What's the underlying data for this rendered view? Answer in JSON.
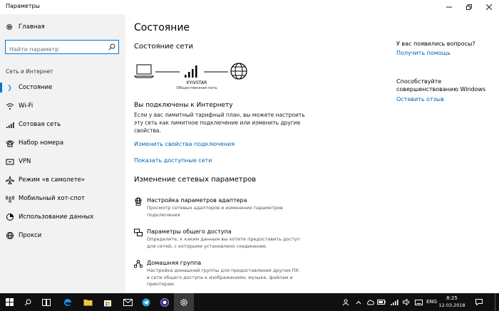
{
  "window": {
    "title": "Параметры"
  },
  "sidebar": {
    "home_label": "Главная",
    "search_placeholder": "Найти параметр",
    "section_title": "Сеть и Интернет",
    "items": [
      {
        "label": "Состояние",
        "icon": "status-icon",
        "active": true
      },
      {
        "label": "Wi-Fi",
        "icon": "wifi-icon"
      },
      {
        "label": "Сотовая сеть",
        "icon": "cellular-icon"
      },
      {
        "label": "Набор номера",
        "icon": "dialup-icon"
      },
      {
        "label": "VPN",
        "icon": "vpn-icon"
      },
      {
        "label": "Режим «в самолете»",
        "icon": "airplane-icon"
      },
      {
        "label": "Мобильный хот-спот",
        "icon": "hotspot-icon"
      },
      {
        "label": "Использование данных",
        "icon": "data-usage-icon"
      },
      {
        "label": "Прокси",
        "icon": "proxy-icon"
      }
    ]
  },
  "main": {
    "title": "Состояние",
    "network_status_heading": "Состояние сети",
    "network_name": "KYIVSTAR",
    "network_type": "Общественная сеть",
    "connected_text": "Вы подключены к Интернету",
    "connected_desc": "Если у вас лимитный тарифный план, вы можете настроить эту сеть как лимитное подключение или изменить другие свойства.",
    "link_change_properties": "Изменить свойства подключения",
    "link_show_networks": "Показать доступные сети",
    "change_heading": "Изменение сетевых параметров",
    "options": [
      {
        "title": "Настройка параметров адаптера",
        "desc": "Просмотр сетевых адаптеров и изменение параметров подключения.",
        "icon": "adapter-icon"
      },
      {
        "title": "Параметры общего доступа",
        "desc": "Определите, к каким данным вы хотите предоставить доступ для сетей, с которыми установлено соединение.",
        "icon": "sharing-icon"
      },
      {
        "title": "Домашняя группа",
        "desc": "Настройка домашней группы для предоставления другим ПК в сети общего доступа к изображениям, музыке, файлам и принтерам.",
        "icon": "homegroup-icon"
      }
    ]
  },
  "right": {
    "questions": "У вас появились вопросы?",
    "get_help": "Получить помощь",
    "improve_line1": "Способствуйте",
    "improve_line2": "совершенствованию Windows",
    "feedback": "Оставить отзыв"
  },
  "taskbar": {
    "language": "ENG",
    "time": "8:25",
    "date": "12.03.2018"
  },
  "colors": {
    "accent": "#0078d7",
    "link": "#0063b1",
    "sidebar_bg": "#f2f2f2",
    "taskbar_bg": "#101010"
  }
}
